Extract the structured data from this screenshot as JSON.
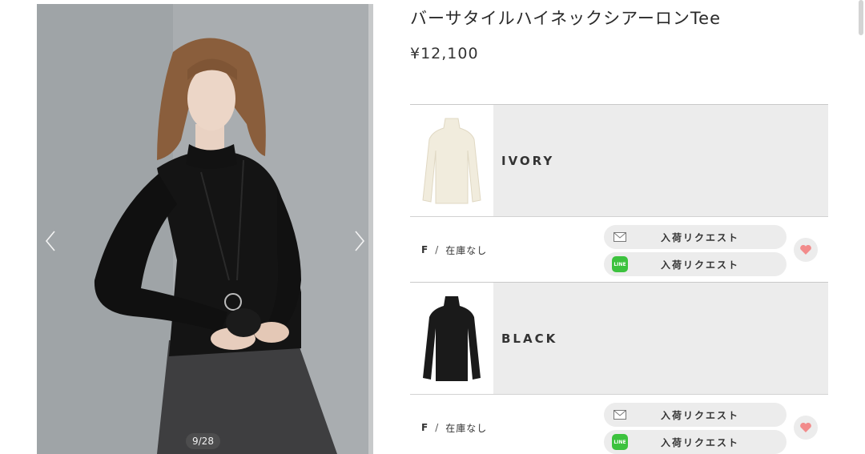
{
  "product": {
    "title": "バーサタイルハイネックシアーロンTee",
    "price": "¥12,100"
  },
  "gallery": {
    "counter": "9/28",
    "prev_icon": "chevron-left-icon",
    "next_icon": "chevron-right-icon"
  },
  "colors": [
    {
      "name": "IVORY",
      "swatch": "#f1ecdd",
      "sizes": [
        {
          "size": "F",
          "separator": "/",
          "stock": "在庫なし",
          "email_request": "入荷リクエスト",
          "line_request": "入荷リクエスト"
        }
      ]
    },
    {
      "name": "BLACK",
      "swatch": "#1a1a1a",
      "sizes": [
        {
          "size": "F",
          "separator": "/",
          "stock": "在庫なし",
          "email_request": "入荷リクエスト",
          "line_request": "入荷リクエスト"
        }
      ]
    }
  ],
  "icons": {
    "email": "mail-icon",
    "line": "line-icon",
    "favorite": "heart-icon"
  },
  "accent": {
    "heart": "#f28b8b",
    "line_green": "#3cc23e"
  }
}
